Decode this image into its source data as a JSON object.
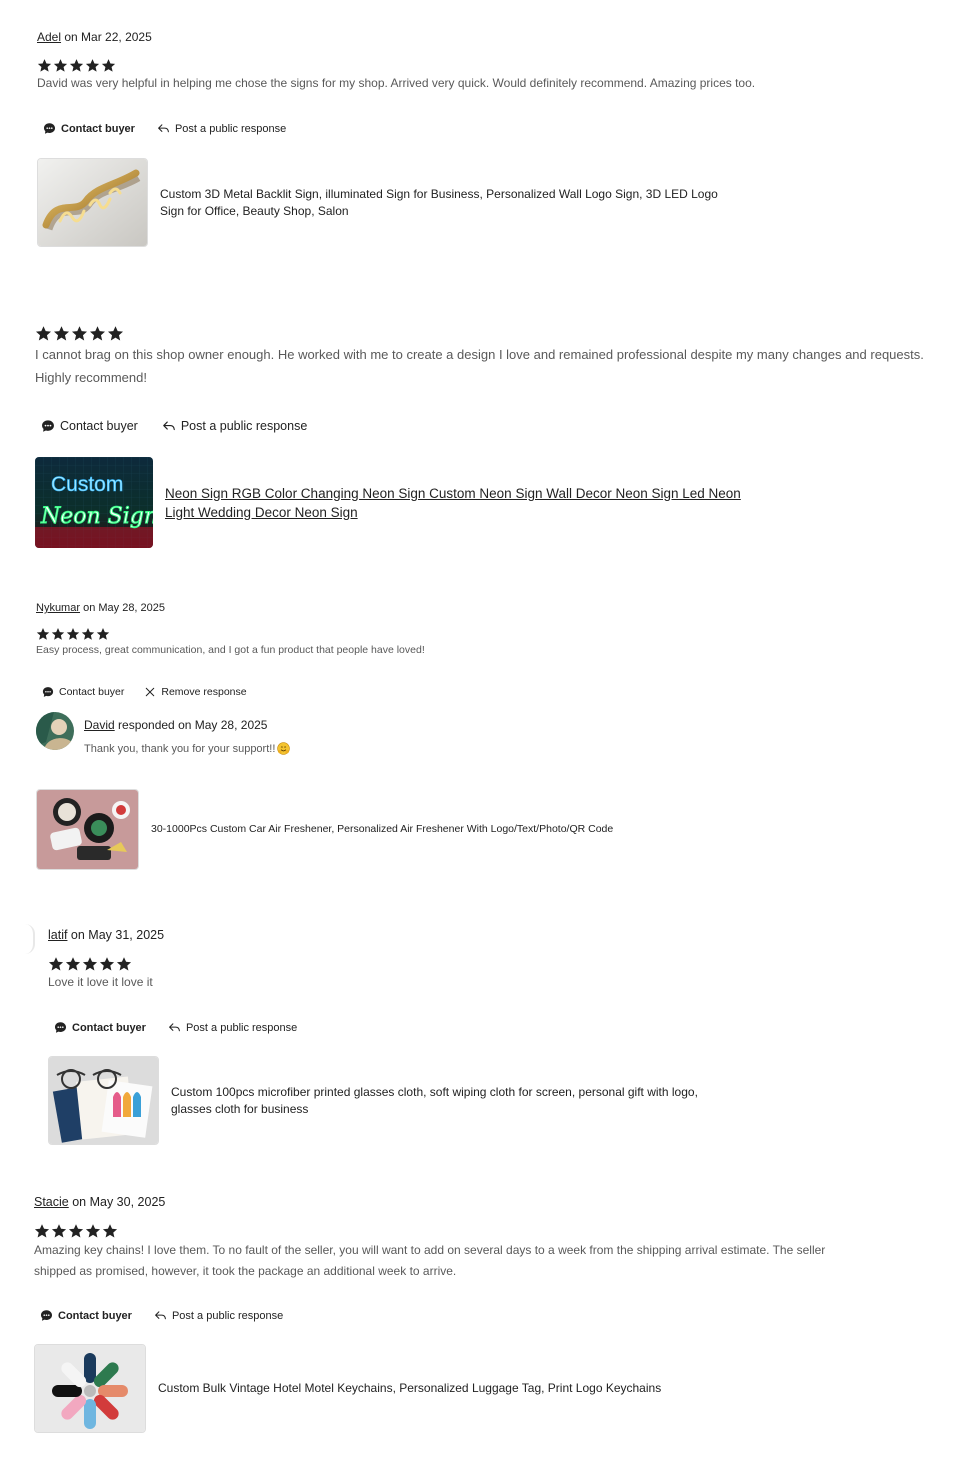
{
  "colors": {
    "text": "#222222",
    "muted": "#595959",
    "star": "#222222"
  },
  "actions": {
    "contact": "Contact buyer",
    "post": "Post a public response",
    "remove": "Remove response"
  },
  "reviews": [
    {
      "reviewer": "Adel",
      "date_text": " on Mar 22, 2025",
      "stars": 5,
      "text": "David was very helpful in helping me chose the signs for my shop. Arrived very quick. Would definitely recommend. Amazing prices too.",
      "product": "Custom 3D Metal Backlit Sign, illuminated Sign for Business, Personalized Wall Logo Sign, 3D LED Logo Sign for Office, Beauty Shop, Salon",
      "product_image": "gold-backlit-sign-thumbnail"
    },
    {
      "stars": 5,
      "text": "I cannot brag on this shop owner enough. He worked with me to create a design I love and remained professional despite my many changes and requests. Highly recommend!",
      "product": "Neon Sign RGB Color Changing Neon Sign Custom Neon Sign Wall Decor Neon Sign Led Neon Light Wedding Decor Neon Sign",
      "product_image": "custom-neon-sign-thumbnail",
      "thumb_text": [
        "Custom",
        "Neon Sign"
      ]
    },
    {
      "reviewer": "Nykumar",
      "date_text": " on May 28, 2025",
      "stars": 5,
      "text": "Easy process, great communication, and I got a fun product that people have loved!",
      "response": {
        "author": "David",
        "date_text": " responded on May 28, 2025",
        "text": "Thank you, thank you for your support!!",
        "emoji": "hugging-face-emoji"
      },
      "product": "30-1000Pcs Custom Car Air Freshener, Personalized Air Freshener With Logo/Text/Photo/QR Code",
      "product_image": "air-freshener-thumbnail"
    },
    {
      "reviewer": "latif",
      "date_text": " on May 31, 2025",
      "stars": 5,
      "text": "Love it love it love it",
      "product": "Custom 100pcs microfiber printed glasses cloth, soft wiping cloth for screen, personal gift with logo, glasses cloth for business",
      "product_image": "glasses-cloth-thumbnail"
    },
    {
      "reviewer": "Stacie",
      "date_text": " on May 30, 2025",
      "stars": 5,
      "text": "Amazing key chains! I love them. To no fault of the seller, you will want to add on several days to a week from the shipping arrival estimate. The seller shipped as promised, however, it took the package an additional week to arrive.",
      "product": "Custom Bulk Vintage Hotel Motel Keychains, Personalized Luggage Tag, Print Logo Keychains",
      "product_image": "motel-keychains-thumbnail"
    }
  ]
}
